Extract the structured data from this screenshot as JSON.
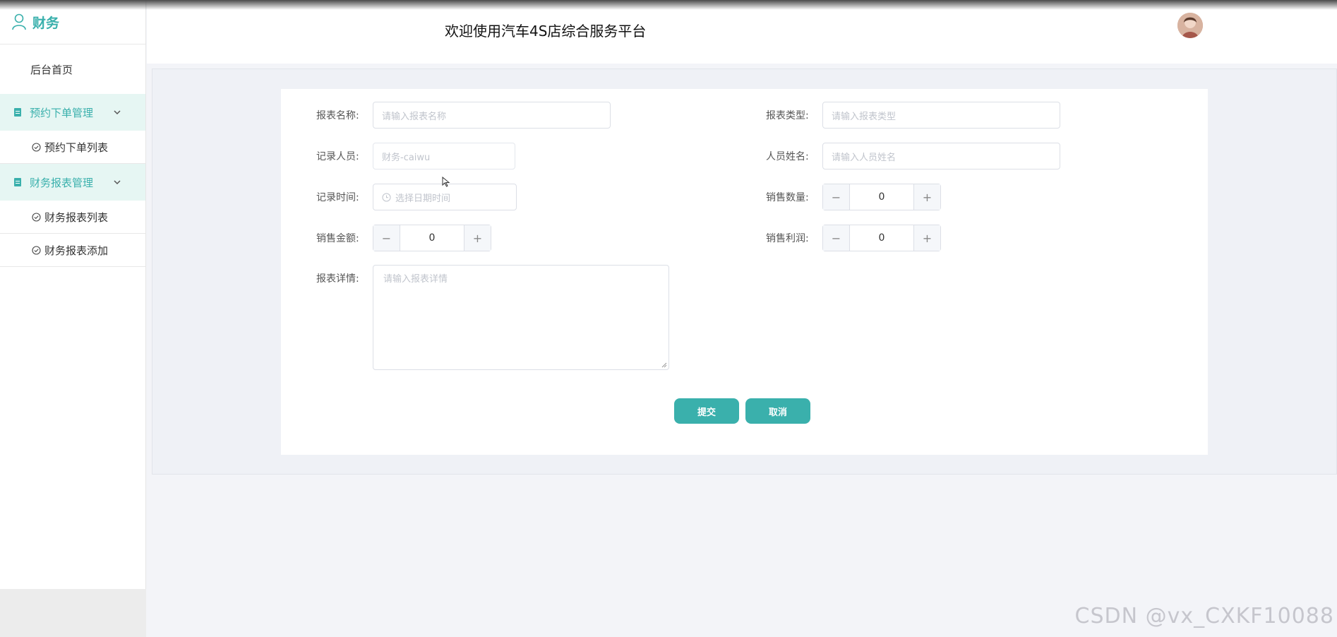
{
  "sidebar": {
    "brand_label": "财务",
    "home_label": "后台首页",
    "groups": [
      {
        "label": "预约下单管理",
        "items": [
          "预约下单列表"
        ]
      },
      {
        "label": "财务报表管理",
        "items": [
          "财务报表列表",
          "财务报表添加"
        ]
      }
    ]
  },
  "header": {
    "title": "欢迎使用汽车4S店综合服务平台"
  },
  "form": {
    "report_name": {
      "label": "报表名称:",
      "placeholder": "请输入报表名称"
    },
    "report_type": {
      "label": "报表类型:",
      "placeholder": "请输入报表类型"
    },
    "recorder": {
      "label": "记录人员:",
      "value": "财务-caiwu"
    },
    "person_name": {
      "label": "人员姓名:",
      "placeholder": "请输入人员姓名"
    },
    "record_time": {
      "label": "记录时间:",
      "placeholder": "选择日期时间"
    },
    "sales_qty": {
      "label": "销售数量:",
      "value": "0"
    },
    "sales_amount": {
      "label": "销售金额:",
      "value": "0"
    },
    "sales_profit": {
      "label": "销售利润:",
      "value": "0"
    },
    "report_detail": {
      "label": "报表详情:",
      "placeholder": "请输入报表详情"
    },
    "submit_label": "提交",
    "cancel_label": "取消",
    "minus_symbol": "−",
    "plus_symbol": "+"
  },
  "watermark": "CSDN @vx_CXKF10088",
  "colors": {
    "accent": "#3ab0ac",
    "accent_bg": "#e6f6f3"
  }
}
